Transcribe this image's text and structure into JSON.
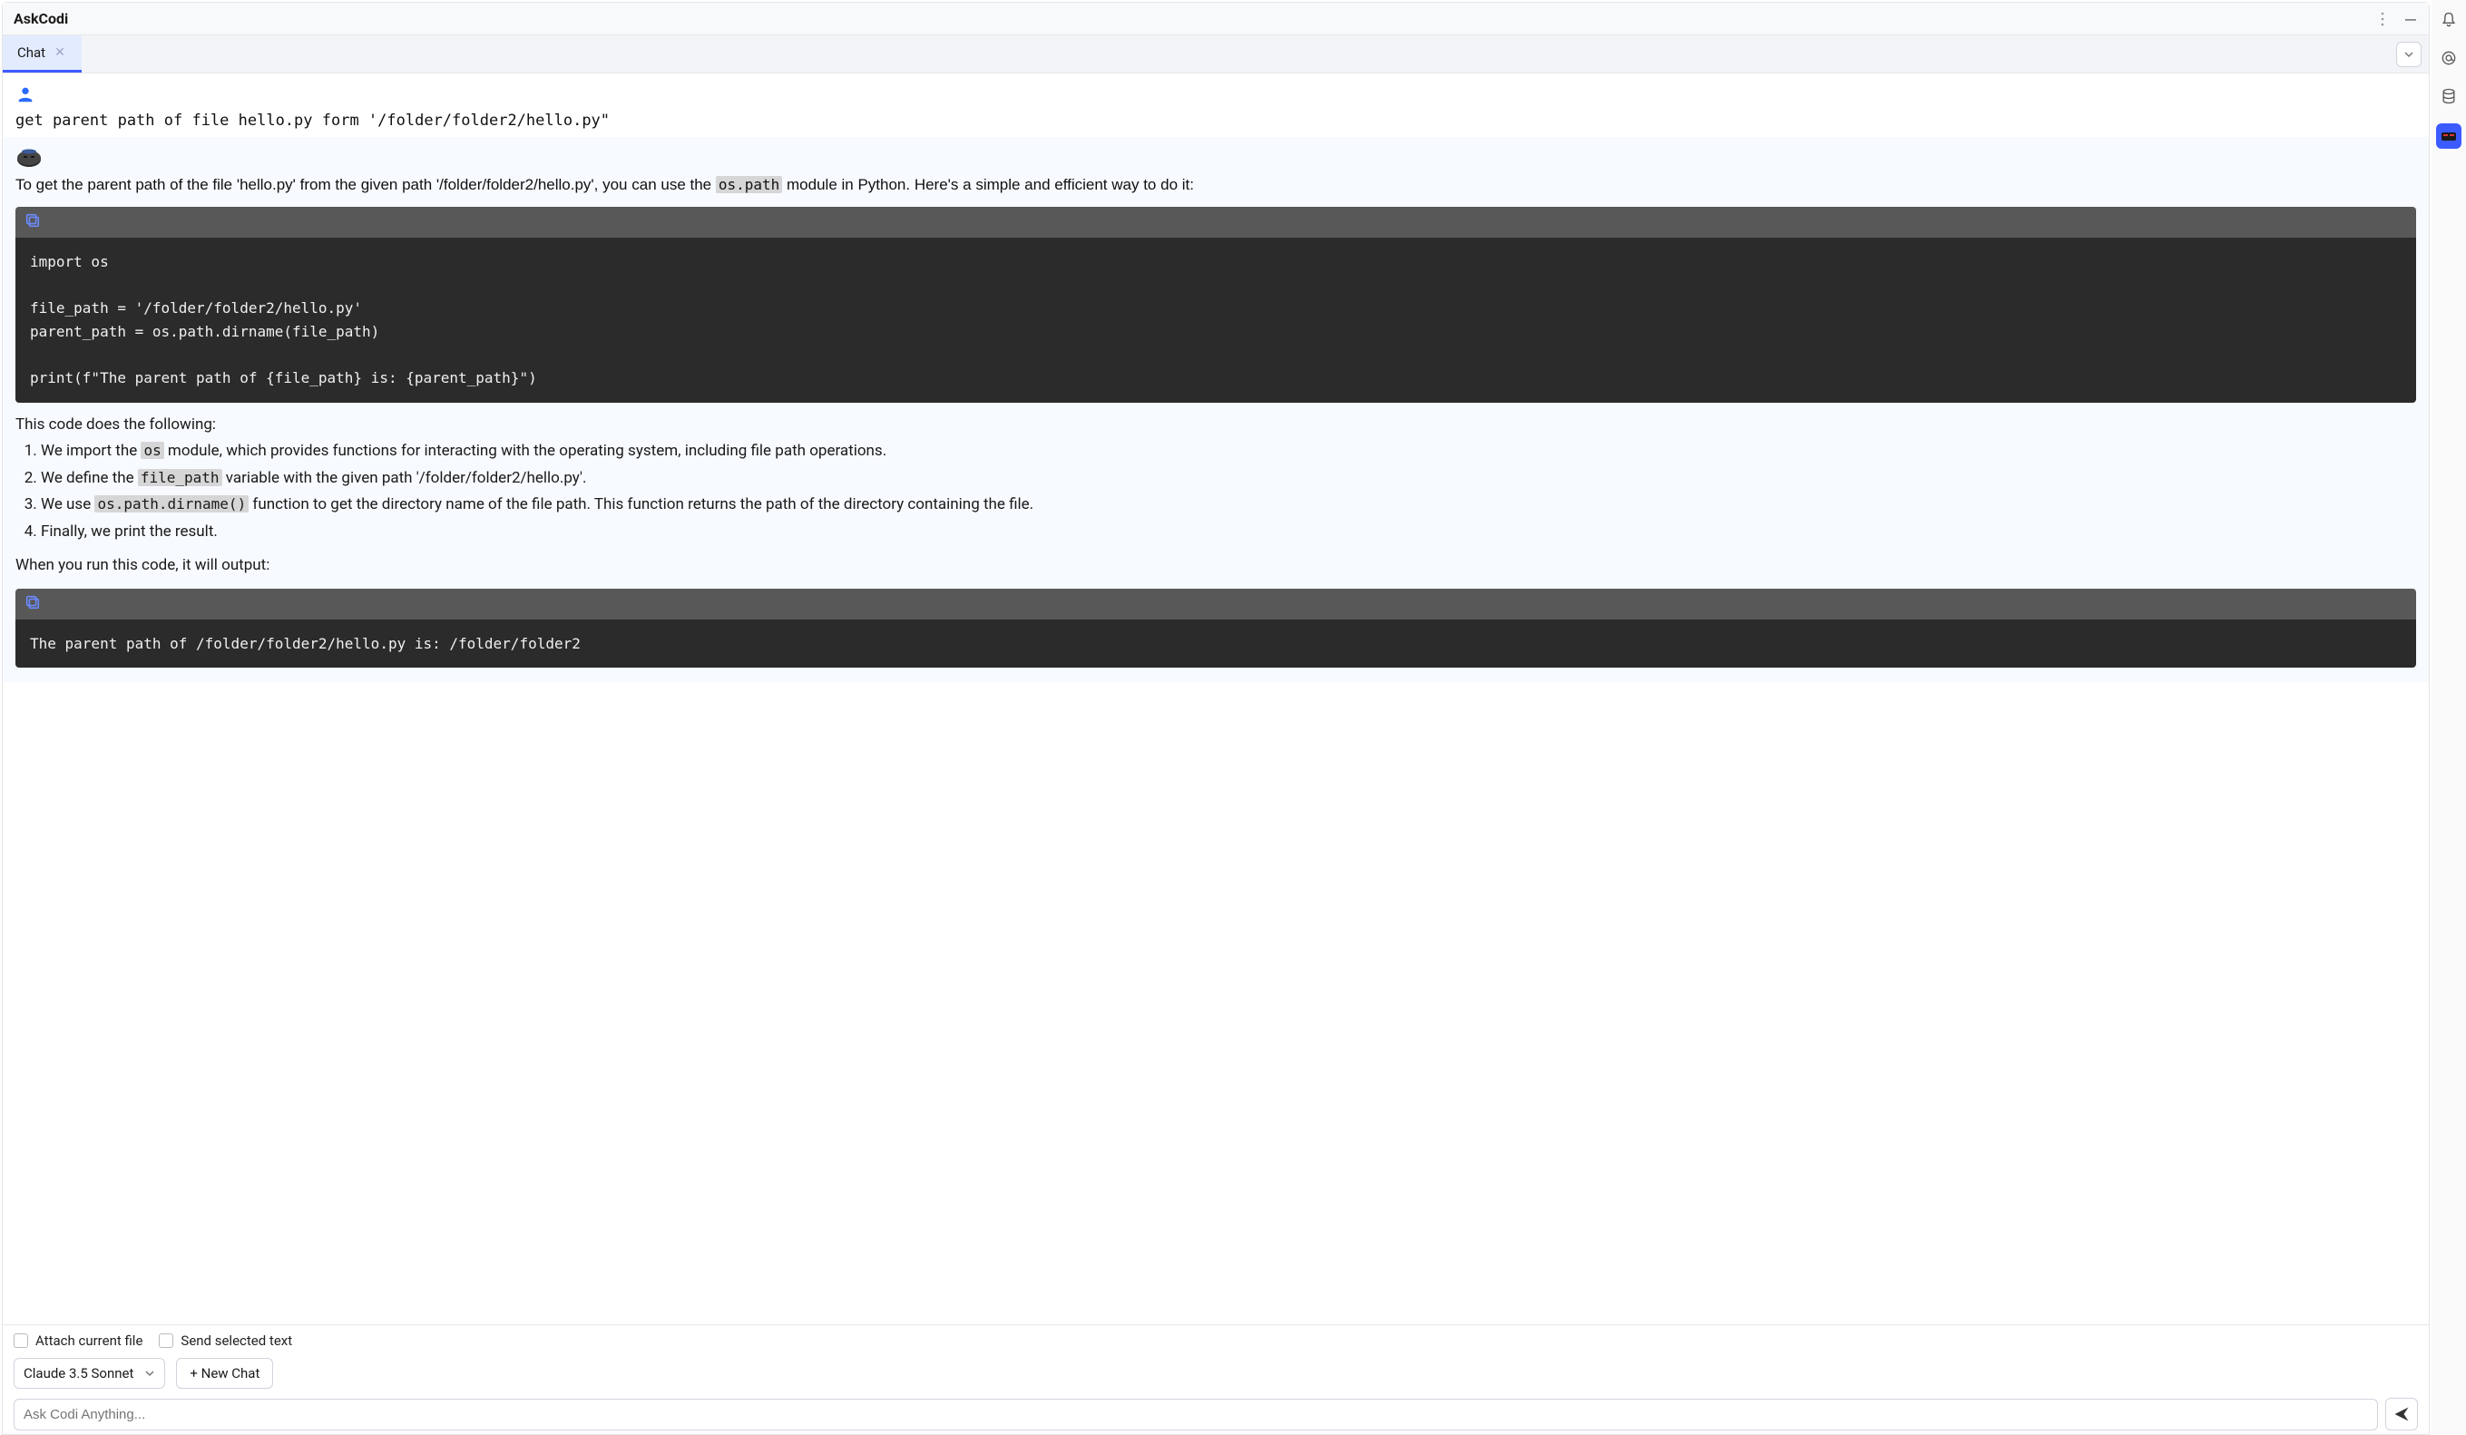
{
  "header": {
    "title": "AskCodi"
  },
  "tabs": [
    {
      "label": "Chat"
    }
  ],
  "user_message": "get parent path of file hello.py form '/folder/folder2/hello.py\"",
  "bot": {
    "intro_pre": "To get the parent path of the file 'hello.py' from the given path '/folder/folder2/hello.py', you can use the ",
    "intro_code": "os.path",
    "intro_post": " module in Python. Here's a simple and efficient way to do it:",
    "code1": "import os\n\nfile_path = '/folder/folder2/hello.py'\nparent_path = os.path.dirname(file_path)\n\nprint(f\"The parent path of {file_path} is: {parent_path}\")",
    "explain_intro": "This code does the following:",
    "steps": [
      {
        "pre": "We import the ",
        "code": "os",
        "post": " module, which provides functions for interacting with the operating system, including file path operations."
      },
      {
        "pre": "We define the ",
        "code": "file_path",
        "post": " variable with the given path '/folder/folder2/hello.py'."
      },
      {
        "pre": "We use ",
        "code": "os.path.dirname()",
        "post": " function to get the directory name of the file path. This function returns the path of the directory containing the file."
      },
      {
        "pre": "Finally, we print the result.",
        "code": "",
        "post": ""
      }
    ],
    "outro": "When you run this code, it will output:",
    "code2": "The parent path of /folder/folder2/hello.py is: /folder/folder2"
  },
  "bottom": {
    "attach_label": "Attach current file",
    "send_selected_label": "Send selected text",
    "model": "Claude 3.5 Sonnet",
    "new_chat": "+ New Chat",
    "placeholder": "Ask Codi Anything..."
  }
}
